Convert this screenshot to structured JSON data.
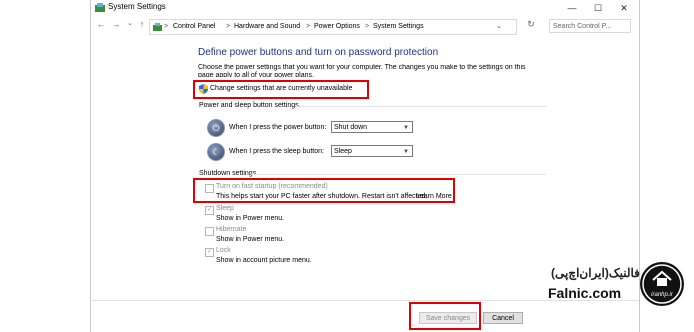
{
  "window": {
    "title": "System Settings",
    "minimize": "—",
    "maximize": "☐",
    "close": "✕"
  },
  "nav": {
    "back": "←",
    "forward": "→",
    "recent": "⌄",
    "up": "↑"
  },
  "address": {
    "crumbs": [
      "Control Panel",
      "Hardware and Sound",
      "Power Options",
      "System Settings"
    ],
    "separator": ">",
    "refresh": "↻"
  },
  "search": {
    "placeholder": "Search Control P..."
  },
  "page": {
    "heading": "Define power buttons and turn on password protection",
    "description": "Choose the power settings that you want for your computer. The changes you make to the settings on this page apply to all of your power plans.",
    "change_link": "Change settings that are currently unavailable"
  },
  "power_section": {
    "title": "Power and sleep button settings",
    "power_button_label": "When I press the power button:",
    "power_button_value": "Shut down",
    "sleep_button_label": "When I press the sleep button:",
    "sleep_button_value": "Sleep"
  },
  "shutdown_section": {
    "title": "Shutdown settings",
    "fast_startup_label": "Turn on fast startup (recommended)",
    "fast_startup_desc": "This helps start your PC faster after shutdown. Restart isn't affected.",
    "learn_more": "Learn More",
    "fast_startup_checked": false,
    "sleep_label": "Sleep",
    "sleep_desc": "Show in Power menu.",
    "sleep_checked": true,
    "hibernate_label": "Hibernate",
    "hibernate_desc": "Show in Power menu.",
    "hibernate_checked": false,
    "lock_label": "Lock",
    "lock_desc": "Show in account picture menu.",
    "lock_checked": true
  },
  "footer": {
    "save": "Save changes",
    "cancel": "Cancel"
  },
  "watermark": {
    "persian": "فالنیک(ایران‌اچ‌پی)",
    "brand": "Falnic.com",
    "logo_text": "iranhp.ir"
  },
  "colors": {
    "heading": "#1e3287",
    "link": "#0066cc",
    "highlight": "#e00000"
  }
}
